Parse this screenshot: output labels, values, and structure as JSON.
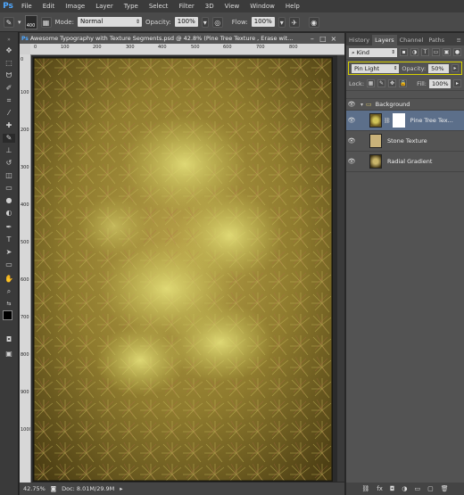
{
  "app": {
    "logo": "Ps"
  },
  "menu": [
    "File",
    "Edit",
    "Image",
    "Layer",
    "Type",
    "Select",
    "Filter",
    "3D",
    "View",
    "Window",
    "Help"
  ],
  "options": {
    "brush_size": "400",
    "mode_label": "Mode:",
    "mode_value": "Normal",
    "opacity_label": "Opacity:",
    "opacity_value": "100%",
    "flow_label": "Flow:",
    "flow_value": "100%"
  },
  "document": {
    "tab_title": "Awesome Typography with Texture Segments.psd @ 42.8% (Pine Tree Texture , Erase wit...",
    "ruler_top": [
      "0",
      "100",
      "200",
      "300",
      "400",
      "500",
      "600",
      "700",
      "800"
    ],
    "ruler_left": [
      "0",
      "100",
      "200",
      "300",
      "400",
      "500",
      "600",
      "700",
      "800",
      "900",
      "1000"
    ]
  },
  "status": {
    "zoom": "42.75%",
    "doc": "Doc: 8.01M/29.9M"
  },
  "panel": {
    "tabs": [
      "History",
      "Layers",
      "Channel",
      "Paths"
    ],
    "active_tab": "Layers",
    "kind_label": "Kind",
    "blend_mode": "Pin Light",
    "opacity_label": "Opacity:",
    "opacity_value": "50%",
    "lock_label": "Lock:",
    "fill_label": "Fill:",
    "fill_value": "100%",
    "group_name": "Background",
    "layers": [
      {
        "name": "Pine Tree Tex...",
        "selected": true,
        "has_mask": true
      },
      {
        "name": "Stone Texture",
        "selected": false,
        "has_mask": false
      },
      {
        "name": "Radial Gradient",
        "selected": false,
        "has_mask": false
      }
    ],
    "footer_icons": [
      "link-icon",
      "fx-icon",
      "mask-icon",
      "adjustment-icon",
      "folder-icon",
      "new-layer-icon",
      "trash-icon"
    ]
  },
  "colors": {
    "highlight": "#d6d000",
    "selected_layer": "#5c6f8a",
    "accent": "#4fa8ff"
  }
}
